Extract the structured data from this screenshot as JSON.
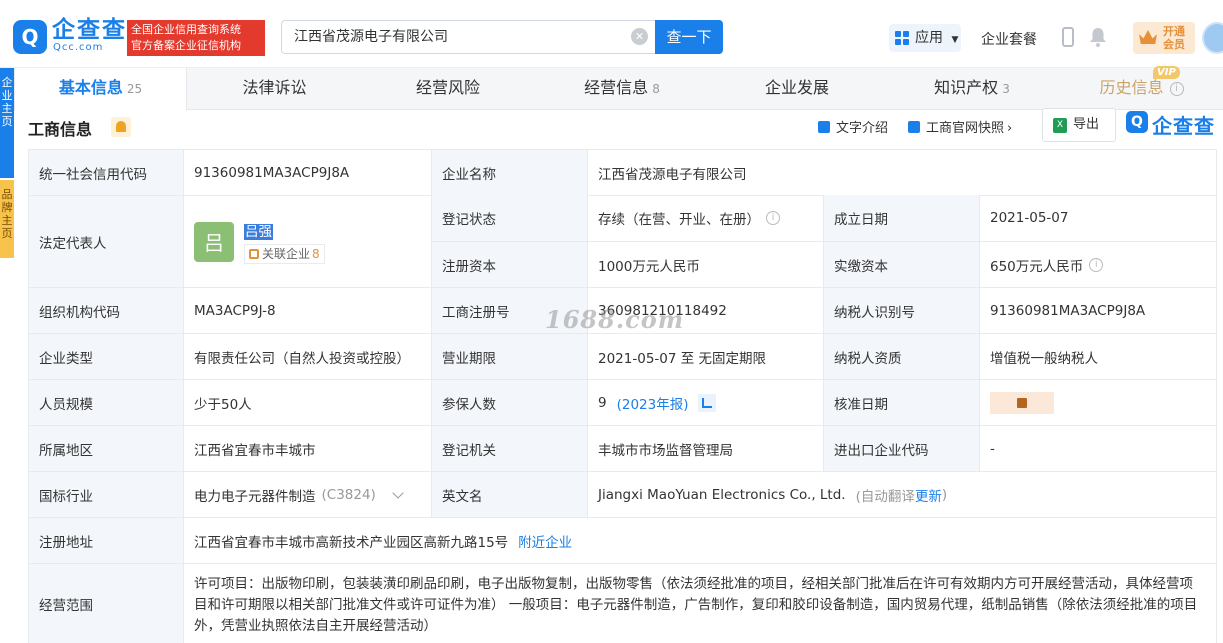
{
  "header": {
    "logo_text": "企查查",
    "logo_sub": "Qcc.com",
    "badge_line1": "全国企业信用查询系统",
    "badge_line2": "官方备案企业征信机构",
    "search_value": "江西省茂源电子有限公司",
    "search_button": "查一下",
    "app_label": "应用",
    "package_label": "企业套餐",
    "vip_line1": "开通",
    "vip_line2": "会员"
  },
  "sidebar_float": {
    "a": "企业主页",
    "b": "品牌主页"
  },
  "tabs": [
    {
      "label": "基本信息",
      "count": "25"
    },
    {
      "label": "法律诉讼",
      "count": ""
    },
    {
      "label": "经营风险",
      "count": ""
    },
    {
      "label": "经营信息",
      "count": "8"
    },
    {
      "label": "企业发展",
      "count": ""
    },
    {
      "label": "知识产权",
      "count": "3"
    },
    {
      "label": "历史信息",
      "count": ""
    }
  ],
  "vip_tag": "VIP",
  "section": {
    "title": "工商信息",
    "text_intro": "文字介绍",
    "snapshot": "工商官网快照",
    "export": "导出",
    "brand": "企查查"
  },
  "info": {
    "credit_code_label": "统一社会信用代码",
    "credit_code": "91360981MA3ACP9J8A",
    "company_name_label": "企业名称",
    "company_name": "江西省茂源电子有限公司",
    "legal_rep_label": "法定代表人",
    "legal_rep_avatar": "吕",
    "legal_rep_name": "吕强",
    "related_label": "关联企业",
    "related_count": "8",
    "reg_status_label": "登记状态",
    "reg_status": "存续（在营、开业、在册）",
    "founded_label": "成立日期",
    "founded": "2021-05-07",
    "reg_capital_label": "注册资本",
    "reg_capital": "1000万元人民币",
    "paid_capital_label": "实缴资本",
    "paid_capital": "650万元人民币",
    "org_code_label": "组织机构代码",
    "org_code": "MA3ACP9J-8",
    "reg_no_label": "工商注册号",
    "reg_no": "360981210118492",
    "taxpayer_id_label": "纳税人识别号",
    "taxpayer_id": "91360981MA3ACP9J8A",
    "type_label": "企业类型",
    "type": "有限责任公司（自然人投资或控股）",
    "term_label": "营业期限",
    "term": "2021-05-07 至 无固定期限",
    "tax_quality_label": "纳税人资质",
    "tax_quality": "增值税一般纳税人",
    "staff_label": "人员规模",
    "staff": "少于50人",
    "insured_label": "参保人数",
    "insured": "9",
    "insured_year": "(2023年报)",
    "approval_label": "核准日期",
    "region_label": "所属地区",
    "region": "江西省宜春市丰城市",
    "authority_label": "登记机关",
    "authority": "丰城市市场监督管理局",
    "import_code_label": "进出口企业代码",
    "import_code": "-",
    "industry_label": "国标行业",
    "industry": "电力电子元器件制造",
    "industry_code": "(C3824)",
    "english_label": "英文名",
    "english": "Jiangxi MaoYuan Electronics Co., Ltd.",
    "auto_translate": "(自动翻译",
    "update": "更新",
    "close_paren": ")",
    "address_label": "注册地址",
    "address": "江西省宜春市丰城市高新技术产业园区高新九路15号",
    "nearby": "附近企业",
    "scope_label": "经营范围",
    "scope": "许可项目：出版物印刷，包装装潢印刷品印刷，电子出版物复制，出版物零售（依法须经批准的项目，经相关部门批准后在许可有效期内方可开展经营活动，具体经营项目和许可期限以相关部门批准文件或许可证件为准） 一般项目：电子元器件制造，广告制作，复印和胶印设备制造，国内贸易代理，纸制品销售（除依法须经批准的项目外，凭营业执照依法自主开展经营活动）"
  },
  "watermark": "1688.com"
}
